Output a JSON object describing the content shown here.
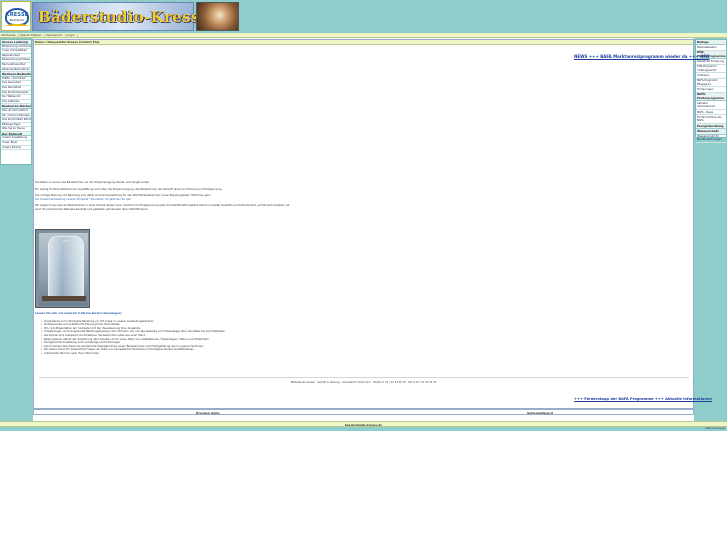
{
  "header": {
    "logo_text": "KRESSE",
    "logo_subtext": "Bäderstudio",
    "banner_title": "Bäderstudio-Kresse"
  },
  "top_nav": [
    "Startseite",
    "Übersichtsplan",
    "Impressum",
    "Login"
  ],
  "breadcrumb": "Home> Nassesetter Kresse Comfort Plus",
  "left_nav": {
    "sections": [
      {
        "title": "Unsere Leistung",
        "items": [
          "Badplanung mit Konzept",
          "Unser Komplettbad",
          "Reparaturbad",
          "Badsanierung/Umbau",
          "Barrierefreies Bad",
          "Wellness-Baderlebnis"
        ]
      },
      {
        "title": "Wellness-Badkultur",
        "items": [
          "Kräfte - Schönheit",
          "Das Saunabad",
          "Das Dampfbad",
          "Das Komfortsanierer",
          "Der Wellsprint",
          "Das Leitfaden"
        ]
      },
      {
        "title": "Bauherren-Werbung",
        "items": [
          "Was ist barrierefrei?",
          "Wir machen Wellness",
          "Das Komfortbad Rahmen",
          "Bäderge-Tipps",
          "Was Sie zu Hause"
        ]
      },
      {
        "title": "Der Badprofi",
        "items": [
          "Unsere Ausstellung",
          "Unser Team",
          "Unsere Partner"
        ]
      }
    ]
  },
  "right_nav": {
    "sections": [
      {
        "title": "Beilage",
        "items": [
          "Wellnessbaden"
        ]
      },
      {
        "title": "KfW-Förderprogramme",
        "items": [
          "Staatliche Förderung",
          "KfW-Programm \"Altersgerecht\"",
          "Umbauen",
          "BAFA-Programm Pflegegrad",
          "Förderungen"
        ]
      },
      {
        "title": "BAFA-Förderprogramm",
        "items": [
          "Aktuelle Informationen",
          "BAFA - News",
          "Förderrichtlinie der BAFA"
        ]
      },
      {
        "title": "Energieberatung",
        "items": []
      },
      {
        "title": "Wasserschutz",
        "items": [
          "Wasserschutz für Kundenwohnungen"
        ]
      }
    ]
  },
  "main": {
    "news_link": "NEWS +++ BAFA Marktanreizprogramm wieder da +++ KfW",
    "intro_paragraphs": [
      "Die Zeiten in denen das Badezimmer nur der Körperreinigung diente, sind längst vorbei.",
      "Ein wohlig Funktionalität bei der Ausstattung auch über die Körperreinigung, das Badezimmer der Zukunft dient zur Erholung und Entspannung.",
      "Die richtige Planung und Beratung sind dabei Grundvoraussetzung für das Wohlfühlbadezimmer. Unser Beratungsteam hilft Ihnen gern.",
      "Wir zeigen Ihnen was ein Badezimmer in einer Stunde leisten kann. Komfort und Entspannung sowie die Wohlfühlatmosphäre führen zu bester Qualität und Zufriedenheit. Auf Wunsch erstellen wir auch Ihr persönliches Wellness-Konzept und gestalten gemeinsam Ihren Wohlfühlraum."
    ],
    "intro_link": "Zur Zusammenstellung unserer Produkte \"Traumbad\" ist jetzt hier für Sie!",
    "features_lead": "Lassen Sie sich von unserem 5-Sterne-Service überzeugen:",
    "features": [
      "Kompetente und individuelle Beratung vor Ort sowie in unserer Ausstellungsräumen",
      "Professionelle und ausführliche Planung Ihres Traumbades",
      "3D-/ 4-D-Präsentation am Computer mit der Visualisierung Ihrer Angebote",
      "Umsetzungen und transparente Beratungsleistung. Wir kümmern uns um alle Gewerke vom Fliesenleger über den Maler bis zum Elektriker.",
      "Sie können sich entspannt zurücklehnen, Sie bekommen alles aus einer Hand.",
      "Reibungsloser Ablauf der Ausführung aller Arbeiten durch unser Team von Installateuren, Fliesenlegern, Malern und Elektrikern",
      "Fachgerechte Umsetzung auch schwieriger Anforderungen",
      "Als krönender Abschluss die persönliche Übergabe Ihres neuen Badezimmers nach Fertigstellung durch unseren Fachmann",
      "Wir bieten Ihnen für persönliche Fragen ein Team von kompetenten Fachleuten mit entsprechenden Qualifikationen",
      "Individuelle Termine nach Ihren Wünschen"
    ],
    "address": "Bäderstudio Kresse · Sanitär & Heizung · Schusterstr. Dortmund · Telefon 0 31 / 12 34 56 78 · Fax 0 31 / 12 34 56 79",
    "promo_link": "+++ Förderstopp der BAFA Programme +++ Aktuelle Informationen"
  },
  "footer_links": {
    "left": "Drucken Seite",
    "right": "Seitenanfang ⊟"
  },
  "footer": "baederstudio-kresse.de",
  "counter": "http://vl-kreis.de"
}
